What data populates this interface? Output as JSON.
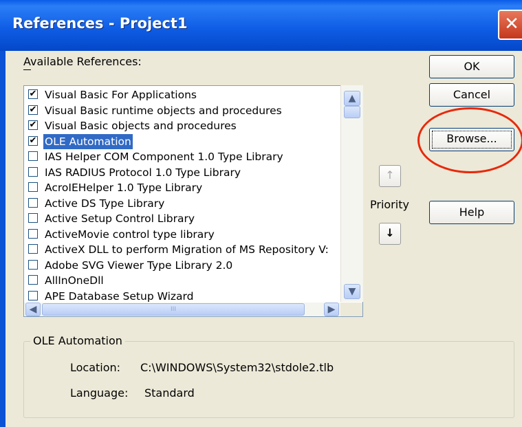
{
  "window": {
    "title": "References - Project1",
    "close_glyph": "✕"
  },
  "references": {
    "label": "Available References:",
    "items": [
      {
        "label": "Visual Basic For Applications",
        "checked": true,
        "selected": false
      },
      {
        "label": "Visual Basic runtime objects and procedures",
        "checked": true,
        "selected": false
      },
      {
        "label": "Visual Basic objects and procedures",
        "checked": true,
        "selected": false
      },
      {
        "label": "OLE Automation",
        "checked": true,
        "selected": true
      },
      {
        "label": " IAS Helper COM Component 1.0 Type Library",
        "checked": false,
        "selected": false
      },
      {
        "label": " IAS RADIUS Protocol 1.0 Type Library",
        "checked": false,
        "selected": false
      },
      {
        "label": "AcroIEHelper 1.0 Type Library",
        "checked": false,
        "selected": false
      },
      {
        "label": "Active DS Type Library",
        "checked": false,
        "selected": false
      },
      {
        "label": "Active Setup Control Library",
        "checked": false,
        "selected": false
      },
      {
        "label": "ActiveMovie control type library",
        "checked": false,
        "selected": false
      },
      {
        "label": "ActiveX DLL to perform Migration of MS Repository V:",
        "checked": false,
        "selected": false
      },
      {
        "label": "Adobe SVG Viewer Type Library 2.0",
        "checked": false,
        "selected": false
      },
      {
        "label": "AllInOneDll",
        "checked": false,
        "selected": false
      },
      {
        "label": "APE Database Setup Wizard",
        "checked": false,
        "selected": false
      }
    ],
    "check_glyph": "✔"
  },
  "buttons": {
    "ok": "OK",
    "cancel": "Cancel",
    "browse": "Browse...",
    "help": "Help"
  },
  "priority": {
    "label": "Priority",
    "up_glyph": "↑",
    "down_glyph": "↓"
  },
  "scroll": {
    "up": "▲",
    "down": "▼",
    "left": "◀",
    "right": "▶",
    "grip": "III"
  },
  "details": {
    "group_title": "OLE Automation",
    "location_label": "Location:",
    "location_value": "C:\\WINDOWS\\System32\\stdole2.tlb",
    "language_label": "Language:",
    "language_value": "Standard"
  },
  "colors": {
    "title_bar": "#0F5EE6",
    "selection": "#316AC5",
    "highlight_circle": "#E8290B"
  }
}
